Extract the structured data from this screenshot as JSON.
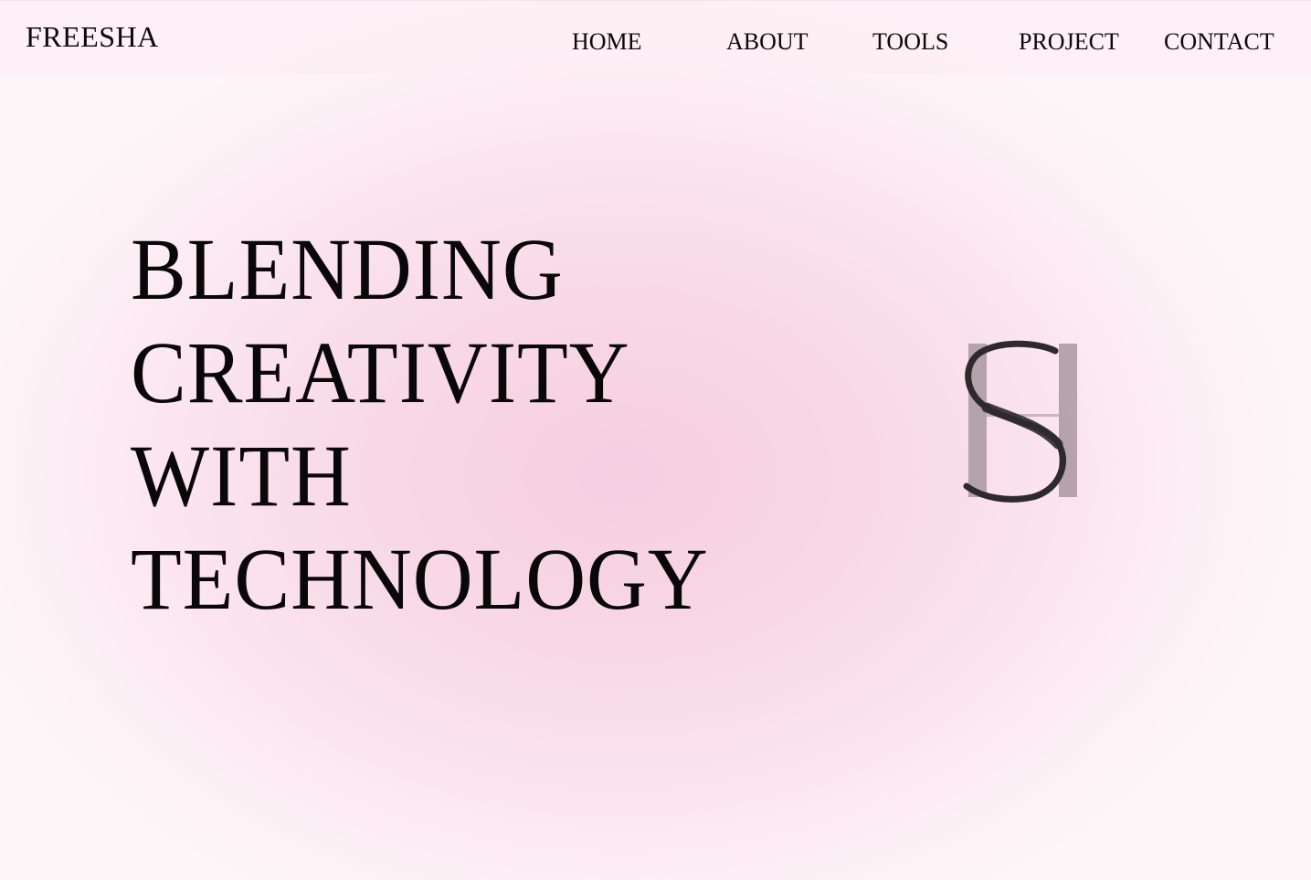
{
  "brand": {
    "name": "FREESHA"
  },
  "nav": {
    "home": "HOME",
    "about": "ABOUT",
    "tools": "TOOLS",
    "project": "PROJECT",
    "contact": "CONTACT"
  },
  "hero": {
    "lines": [
      "BLENDING",
      "CREATIVITY",
      "WITH",
      "TECHNOLOGY"
    ]
  },
  "monogram": {
    "icon": "sh-monogram-icon",
    "bar_color": "#a898a0",
    "letter_color": "#2e2a2c"
  },
  "colors": {
    "background_center": "#f6cfe1",
    "background_edge": "#fdf6f9",
    "text": "#0d0a0b"
  }
}
